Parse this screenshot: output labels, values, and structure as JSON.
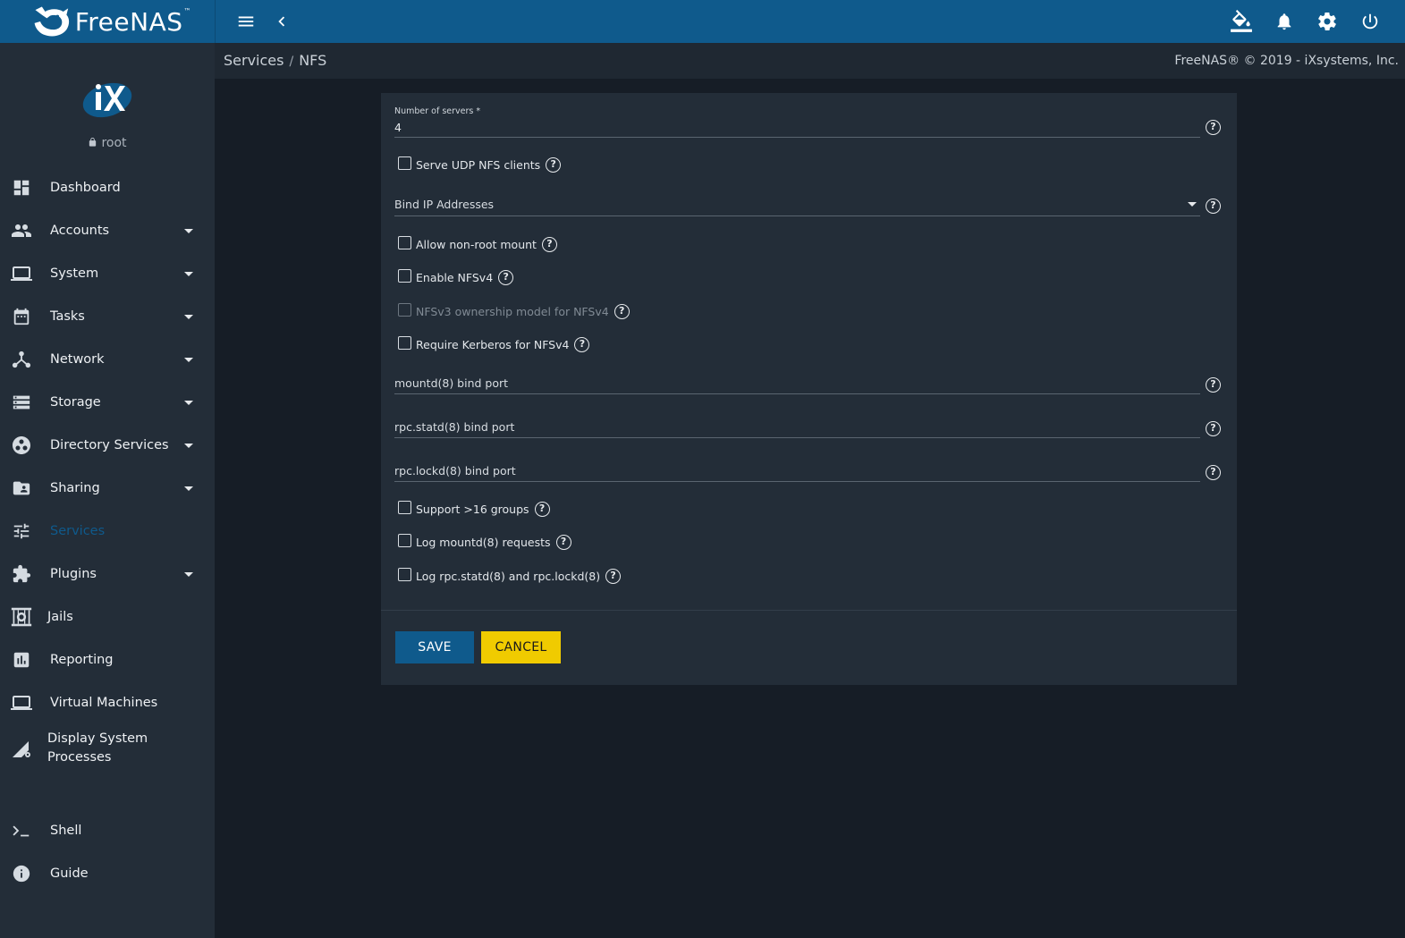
{
  "app": {
    "brand": "FreeNAS",
    "brand_tm": "™"
  },
  "topbar": {
    "icons": [
      "menu-icon",
      "chevron-left-icon",
      "theme-bucket-icon",
      "bell-icon",
      "gear-icon",
      "power-icon"
    ]
  },
  "sidebar": {
    "user": "root",
    "items": [
      {
        "label": "Dashboard",
        "icon": "dashboard-icon",
        "expandable": false
      },
      {
        "label": "Accounts",
        "icon": "people-icon",
        "expandable": true
      },
      {
        "label": "System",
        "icon": "laptop-icon",
        "expandable": true
      },
      {
        "label": "Tasks",
        "icon": "calendar-icon",
        "expandable": true
      },
      {
        "label": "Network",
        "icon": "network-icon",
        "expandable": true
      },
      {
        "label": "Storage",
        "icon": "storage-icon",
        "expandable": true
      },
      {
        "label": "Directory Services",
        "icon": "directory-icon",
        "expandable": true
      },
      {
        "label": "Sharing",
        "icon": "folder-shared-icon",
        "expandable": true
      },
      {
        "label": "Services",
        "icon": "tune-icon",
        "expandable": false,
        "active": true
      },
      {
        "label": "Plugins",
        "icon": "puzzle-icon",
        "expandable": true
      },
      {
        "label": "Jails",
        "icon": "jail-icon",
        "expandable": false
      },
      {
        "label": "Reporting",
        "icon": "chart-icon",
        "expandable": false
      },
      {
        "label": "Virtual Machines",
        "icon": "laptop-icon",
        "expandable": false
      },
      {
        "label": "Display System Processes",
        "icon": "process-icon",
        "expandable": false
      },
      {
        "label": "Shell",
        "icon": "shell-icon",
        "expandable": false
      },
      {
        "label": "Guide",
        "icon": "info-icon",
        "expandable": false
      }
    ]
  },
  "breadcrumb": {
    "items": [
      "Services",
      "NFS"
    ],
    "separator": "/",
    "copyright": "FreeNAS® © 2019 - iXsystems, Inc."
  },
  "form": {
    "num_servers_label": "Number of servers *",
    "num_servers_value": "4",
    "udp_label": "Serve UDP NFS clients",
    "bind_ip_label": "Bind IP Addresses",
    "allow_nonroot_label": "Allow non-root mount",
    "nfsv4_label": "Enable NFSv4",
    "nfsv3_owner_label": "NFSv3 ownership model for NFSv4",
    "kerberos_label": "Require Kerberos for NFSv4",
    "mountd_port_label": "mountd(8) bind port",
    "statd_port_label": "rpc.statd(8) bind port",
    "lockd_port_label": "rpc.lockd(8) bind port",
    "groups16_label": "Support >16 groups",
    "log_mountd_label": "Log mountd(8) requests",
    "log_statd_label": "Log rpc.statd(8) and rpc.lockd(8)",
    "help_glyph": "?",
    "save_label": "SAVE",
    "cancel_label": "CANCEL"
  },
  "colors": {
    "topbar": "#0f5a8c",
    "sidebar": "#232d38",
    "background": "#161d26",
    "save": "#0f5a8c",
    "cancel": "#f0cb00"
  }
}
